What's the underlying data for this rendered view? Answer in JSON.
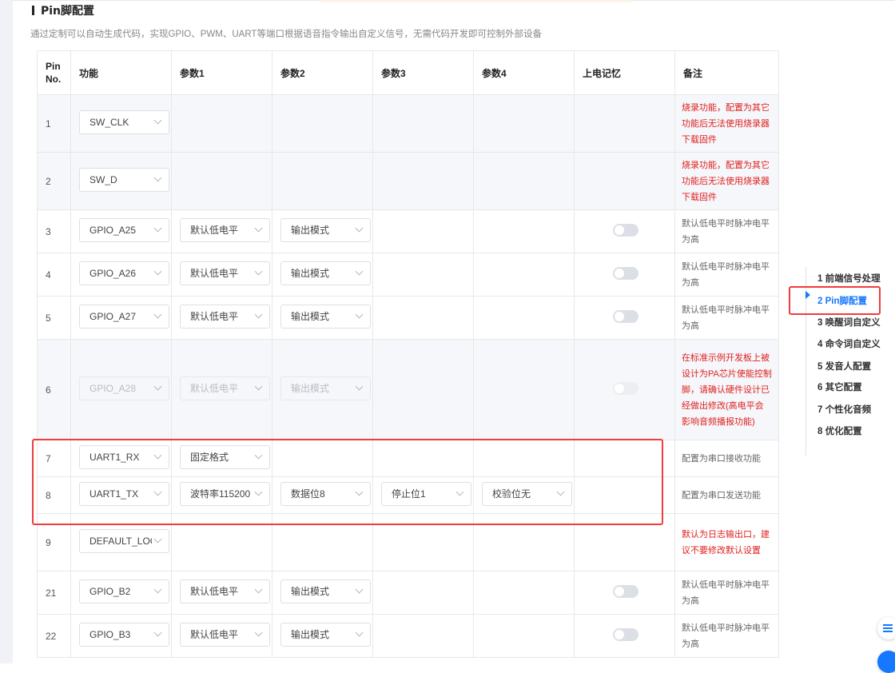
{
  "section": {
    "title": "Pin脚配置",
    "subtitle": "通过定制可以自动生成代码，实现GPIO、PWM、UART等端口根据语音指令输出自定义信号，无需代码开发即可控制外部设备"
  },
  "table": {
    "headers": {
      "pin_line1": "Pin",
      "pin_line2": "No.",
      "function": "功能",
      "param1": "参数1",
      "param2": "参数2",
      "param3": "参数3",
      "param4": "参数4",
      "power_memory": "上电记忆",
      "note": "备注"
    },
    "rows": [
      {
        "pin": "1",
        "function": "SW_CLK",
        "note": "烧录功能，配置为其它功能后无法使用烧录器下载固件"
      },
      {
        "pin": "2",
        "function": "SW_D",
        "note": "烧录功能，配置为其它功能后无法使用烧录器下载固件"
      },
      {
        "pin": "3",
        "function": "GPIO_A25",
        "param1": "默认低电平",
        "param2": "输出模式",
        "note": "默认低电平时脉冲电平为高"
      },
      {
        "pin": "4",
        "function": "GPIO_A26",
        "param1": "默认低电平",
        "param2": "输出模式",
        "note": "默认低电平时脉冲电平为高"
      },
      {
        "pin": "5",
        "function": "GPIO_A27",
        "param1": "默认低电平",
        "param2": "输出模式",
        "note": "默认低电平时脉冲电平为高"
      },
      {
        "pin": "6",
        "function": "GPIO_A28",
        "param1": "默认低电平",
        "param2": "输出模式",
        "note": "在标准示例开发板上被设计为PA芯片使能控制脚，请确认硬件设计已经做出修改(高电平会影响音频播报功能)"
      },
      {
        "pin": "7",
        "function": "UART1_RX",
        "param1": "固定格式",
        "note": "配置为串口接收功能"
      },
      {
        "pin": "8",
        "function": "UART1_TX",
        "param1": "波特率115200",
        "param2": "数据位8",
        "param3": "停止位1",
        "param4": "校验位无",
        "note": "配置为串口发送功能"
      },
      {
        "pin": "9",
        "function": "DEFAULT_LOG",
        "note": "默认为日志输出口，建议不要修改默认设置"
      },
      {
        "pin": "21",
        "function": "GPIO_B2",
        "param1": "默认低电平",
        "param2": "输出模式",
        "note": "默认低电平时脉冲电平为高"
      },
      {
        "pin": "22",
        "function": "GPIO_B3",
        "param1": "默认低电平",
        "param2": "输出模式",
        "note": "默认低电平时脉冲电平为高"
      }
    ]
  },
  "toc": {
    "items": [
      {
        "label": "1  前端信号处理"
      },
      {
        "label": "2  Pin脚配置"
      },
      {
        "label": "3  唤醒词自定义"
      },
      {
        "label": "4  命令词自定义"
      },
      {
        "label": "5  发音人配置"
      },
      {
        "label": "6  其它配置"
      },
      {
        "label": "7  个性化音频"
      },
      {
        "label": "8  优化配置"
      }
    ],
    "active_index": 1
  },
  "colors": {
    "accent": "#1677ff",
    "warning_text": "#e02020",
    "highlight_box": "#f03c3c"
  },
  "icons": {
    "toc_active": "triangle-right-icon",
    "float_list": "list-icon",
    "select_arrow": "chevron-down-icon"
  }
}
